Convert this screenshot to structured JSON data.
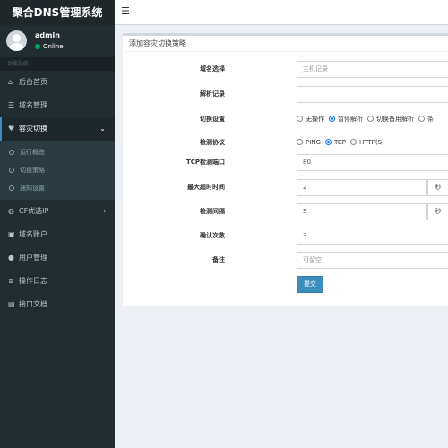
{
  "app": {
    "title": "聚合DNS管理系统"
  },
  "user": {
    "name": "admin",
    "status": "Online"
  },
  "sidebar": {
    "header": "功能导航",
    "items": [
      {
        "label": "后台首页",
        "icon": "home-icon"
      },
      {
        "label": "域名管理",
        "icon": "list-icon"
      },
      {
        "label": "容灾切换",
        "icon": "heartbeat-icon"
      },
      {
        "label": "CF优选IP",
        "icon": "globe-icon"
      },
      {
        "label": "域名账户",
        "icon": "lock-icon"
      },
      {
        "label": "用户管理",
        "icon": "user-icon"
      },
      {
        "label": "操作日志",
        "icon": "log-icon"
      },
      {
        "label": "接口文档",
        "icon": "doc-icon"
      }
    ],
    "submenu": [
      {
        "label": "运行概览"
      },
      {
        "label": "切换策略"
      },
      {
        "label": "通知设置"
      }
    ]
  },
  "form": {
    "title": "添加容灾切换策略",
    "domain": {
      "label": "域名选择",
      "placeholder": "主机记录"
    },
    "record": {
      "label": "解析记录",
      "value": ""
    },
    "switch": {
      "label": "切换设置",
      "options": [
        "无操作",
        "暂停解析",
        "切换备用解析",
        "条"
      ],
      "selected": "暂停解析"
    },
    "protocol": {
      "label": "检测协议",
      "options": [
        "PING",
        "TCP",
        "HTTP(S)"
      ],
      "selected": "TCP"
    },
    "port": {
      "label": "TCP检测端口",
      "value": "80"
    },
    "timeout": {
      "label": "最大超时时间",
      "value": "2",
      "unit": "秒"
    },
    "interval": {
      "label": "检测间隔",
      "value": "5",
      "unit": "秒"
    },
    "confirm": {
      "label": "确认次数",
      "value": "3"
    },
    "remark": {
      "label": "备注",
      "placeholder": "可留空"
    },
    "submit_label": "提交"
  }
}
